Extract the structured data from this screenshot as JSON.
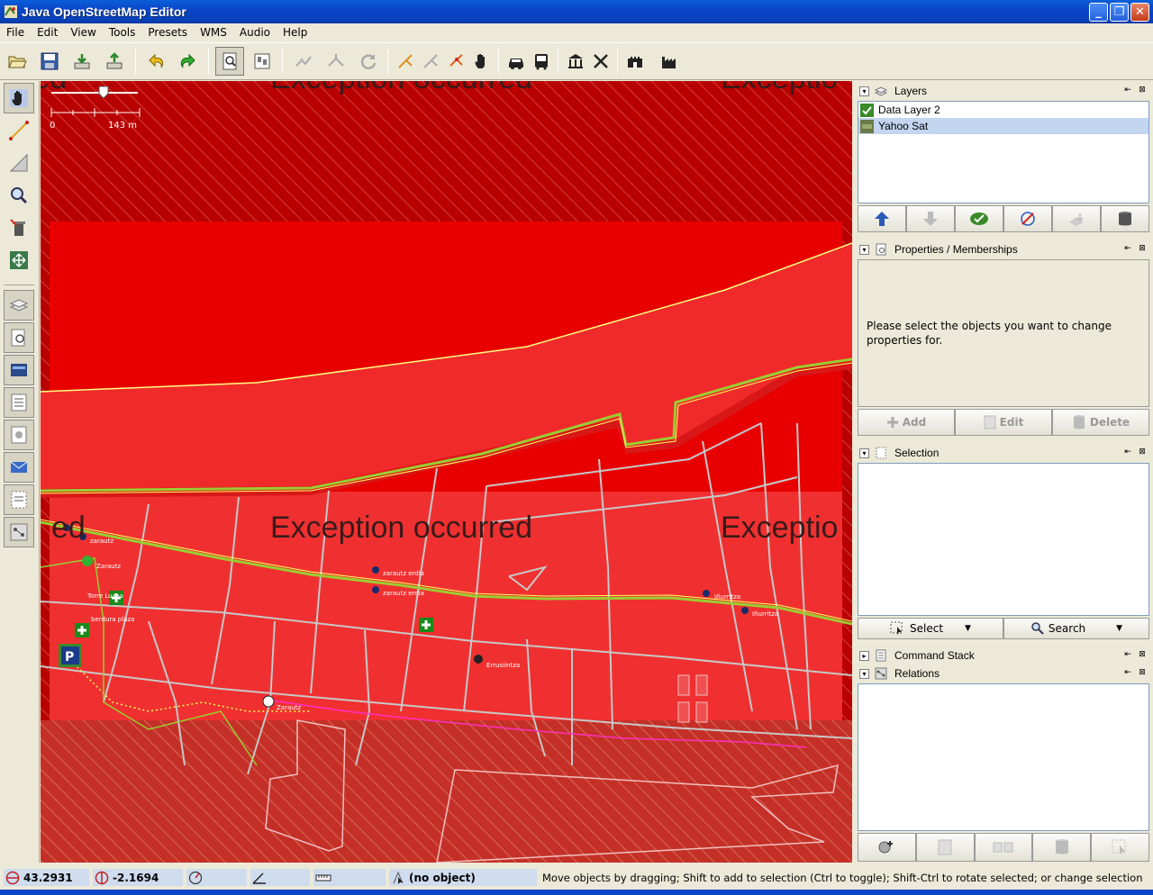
{
  "window": {
    "title": "Java OpenStreetMap Editor"
  },
  "menu": [
    "File",
    "Edit",
    "View",
    "Tools",
    "Presets",
    "WMS",
    "Audio",
    "Help"
  ],
  "map": {
    "scale_start": "0",
    "scale_end": "143 m",
    "exception_text_1": "Exception occurred",
    "exception_text_2": "Exception occurred",
    "exception_text_3": "Exceptio",
    "exception_text_4": "Exception occurred",
    "exception_text_5": "Exceptio",
    "exception_text_6": "ed",
    "exception_text_7": "red",
    "labels": [
      "zarautz",
      "Zarautz",
      "Torre Luzea",
      "berdura plaza",
      "zarautz erdia",
      "zarautz erdia",
      "Iñurritza",
      "Iñurritza",
      "Errusiintza",
      "Zarautz"
    ]
  },
  "layers": {
    "title": "Layers",
    "items": [
      {
        "name": "Data Layer 2",
        "selected": false
      },
      {
        "name": "Yahoo Sat",
        "selected": true
      }
    ]
  },
  "properties": {
    "title": "Properties / Memberships",
    "empty_message": "Please select the objects you want to change properties for.",
    "add_label": "Add",
    "edit_label": "Edit",
    "delete_label": "Delete"
  },
  "selection": {
    "title": "Selection",
    "select_label": "Select",
    "search_label": "Search"
  },
  "command_stack": {
    "title": "Command Stack"
  },
  "relations": {
    "title": "Relations"
  },
  "status": {
    "lat": "43.2931",
    "lon": "-2.1694",
    "heading": "",
    "angle": "",
    "distance": "",
    "object": "(no object)",
    "message": "Move objects by dragging; Shift to add to selection (Ctrl to toggle); Shift-Ctrl to rotate selected; or change selection"
  },
  "colors": {
    "map_dark": "#b50000",
    "map_red": "#f03030",
    "way": "#c8c8c8",
    "highlight": "#9acd32"
  }
}
